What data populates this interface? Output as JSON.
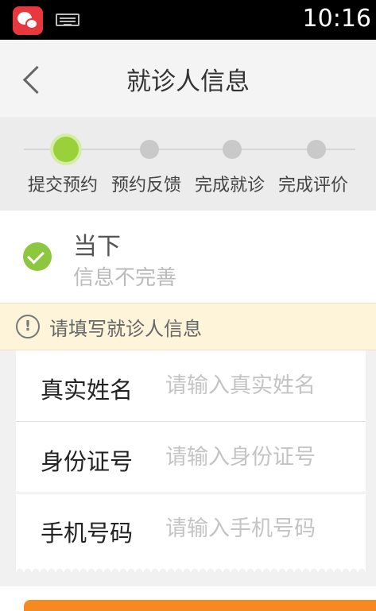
{
  "statusbar": {
    "time": "10:16"
  },
  "header": {
    "title": "就诊人信息"
  },
  "steps": [
    {
      "label": "提交预约",
      "active": true
    },
    {
      "label": "预约反馈",
      "active": false
    },
    {
      "label": "完成就诊",
      "active": false
    },
    {
      "label": "完成评价",
      "active": false
    }
  ],
  "status": {
    "title": "当下",
    "subtitle": "信息不完善"
  },
  "notice": {
    "icon": "!",
    "text": "请填写就诊人信息"
  },
  "form": {
    "fields": [
      {
        "label": "真实姓名",
        "value": "",
        "placeholder": "请输入真实姓名"
      },
      {
        "label": "身份证号",
        "value": "",
        "placeholder": "请输入身份证号"
      },
      {
        "label": "手机号码",
        "value": "",
        "placeholder": "请输入手机号码"
      }
    ]
  },
  "colors": {
    "accent_green": "#9ad13a",
    "accent_orange": "#f58a20",
    "notice_bg": "#fdf4da"
  }
}
